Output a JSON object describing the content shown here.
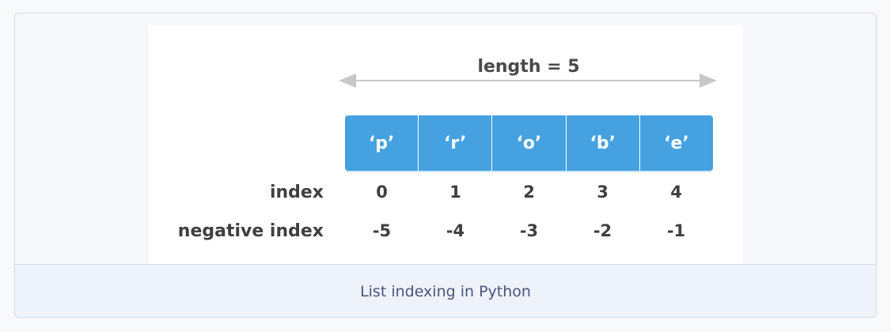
{
  "diagram": {
    "length_label": "length = 5",
    "elements": [
      "‘p’",
      "‘r’",
      "‘o’",
      "‘b’",
      "‘e’"
    ],
    "index_label": "index",
    "indices": [
      "0",
      "1",
      "2",
      "3",
      "4"
    ],
    "negative_index_label": "negative index",
    "negative_indices": [
      "-5",
      "-4",
      "-3",
      "-2",
      "-1"
    ],
    "colors": {
      "cell": "#46a1e1",
      "arrow": "#c8c8c8",
      "text": "#3f3f3f"
    }
  },
  "caption": "List indexing in Python"
}
